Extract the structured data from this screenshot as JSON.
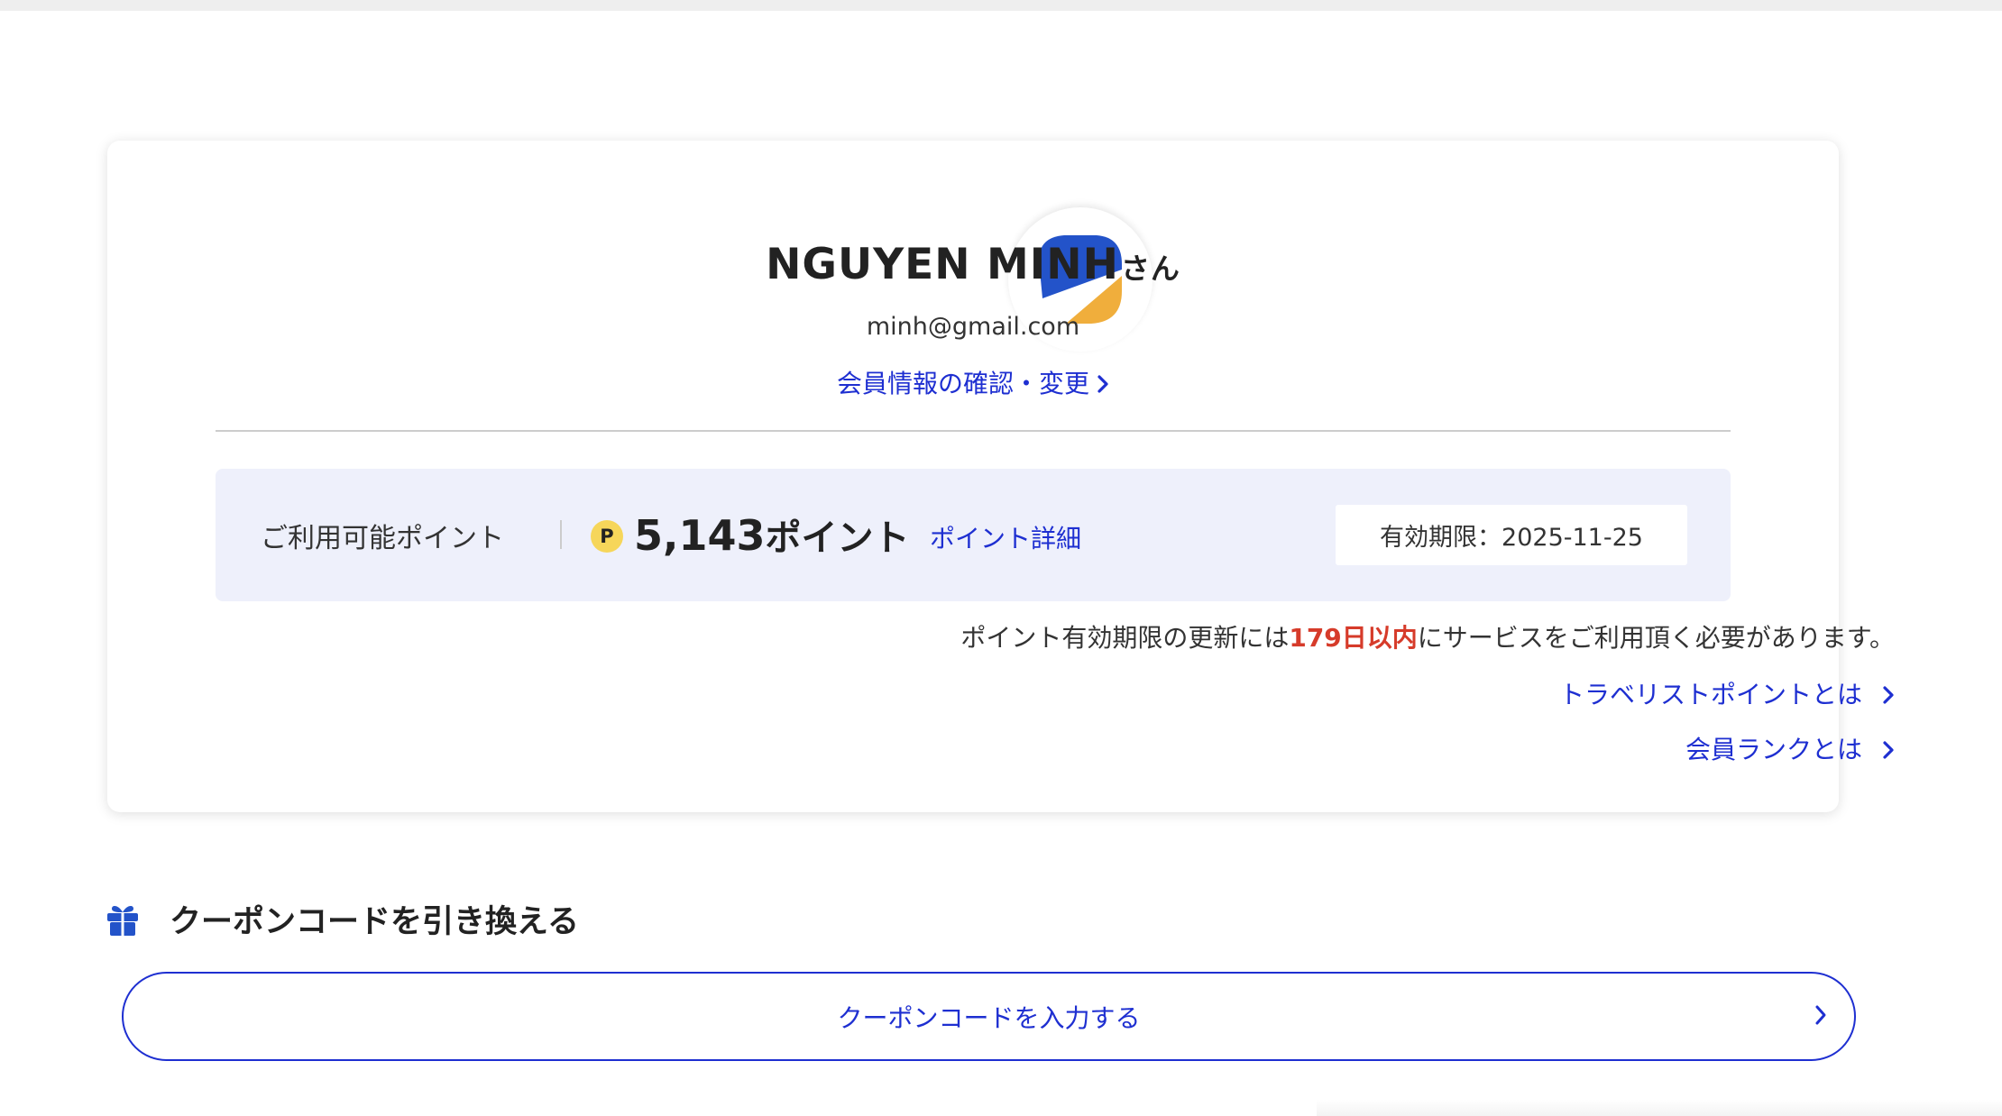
{
  "user": {
    "name": "NGUYEN MINH",
    "honorific": "さん",
    "email": "minh@gmail.com",
    "profile_link_label": "会員情報の確認・変更"
  },
  "points": {
    "label": "ご利用可能ポイント",
    "coin_symbol": "P",
    "amount": "5,143",
    "unit": "ポイント",
    "detail_link_label": "ポイント詳細",
    "expiry_label": "有効期限：2025-11-25"
  },
  "renewal_note": {
    "prefix": "ポイント有効期限の更新には",
    "highlight": "179日以内",
    "suffix": "にサービスをご利用頂く必要があります。"
  },
  "info_links": {
    "travelist_points": "トラベリストポイントとは",
    "member_rank": "会員ランクとは"
  },
  "coupon": {
    "heading": "クーポンコードを引き換える",
    "button_label": "クーポンコードを入力する"
  },
  "colors": {
    "link_blue": "#1e2fd1",
    "highlight_red": "#d63b2a",
    "points_bg": "#eef0fb",
    "logo_blue": "#2353c9",
    "logo_orange": "#f0ae3c",
    "coin_yellow": "#f6d65a"
  },
  "icons": {
    "logo": "travelist-logo-icon",
    "chevron": "chevron-right-icon",
    "gift": "gift-icon",
    "coin": "point-coin-icon"
  }
}
